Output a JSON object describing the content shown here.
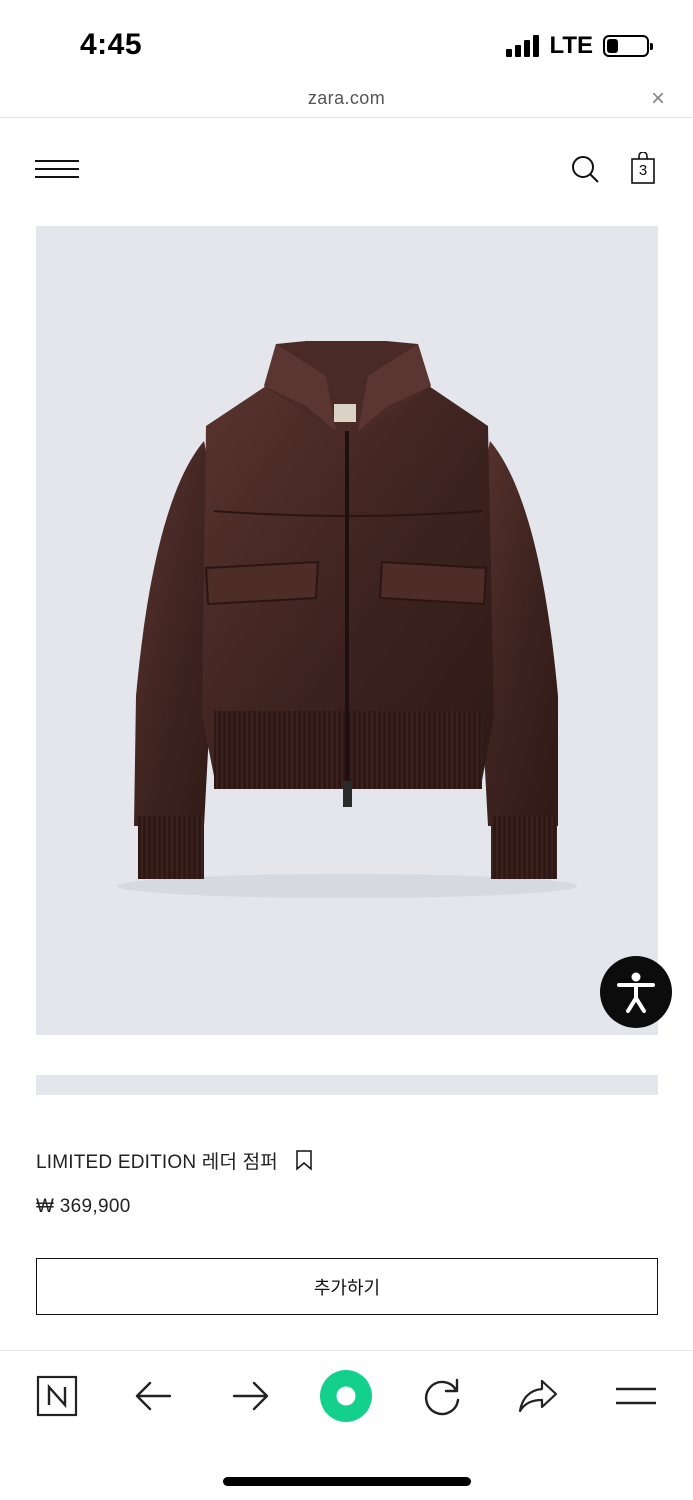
{
  "status_bar": {
    "time": "4:45",
    "network": "LTE",
    "signal_bars": 4,
    "battery_level": 0.3
  },
  "url_bar": {
    "domain": "zara.com",
    "close_label": "×"
  },
  "header": {
    "cart_count": "3"
  },
  "product": {
    "name": "LIMITED EDITION 레더 점퍼",
    "price": "₩ 369,900",
    "add_button_label": "추가하기",
    "image_background": "#e4e6ec",
    "jacket_color": "#3f2420"
  },
  "toolbar": {
    "accent_color": "#13d08c",
    "items": [
      "naver-app-icon",
      "back-arrow-icon",
      "forward-arrow-icon",
      "green-dot-icon",
      "reload-icon",
      "share-icon",
      "menu-icon"
    ]
  }
}
